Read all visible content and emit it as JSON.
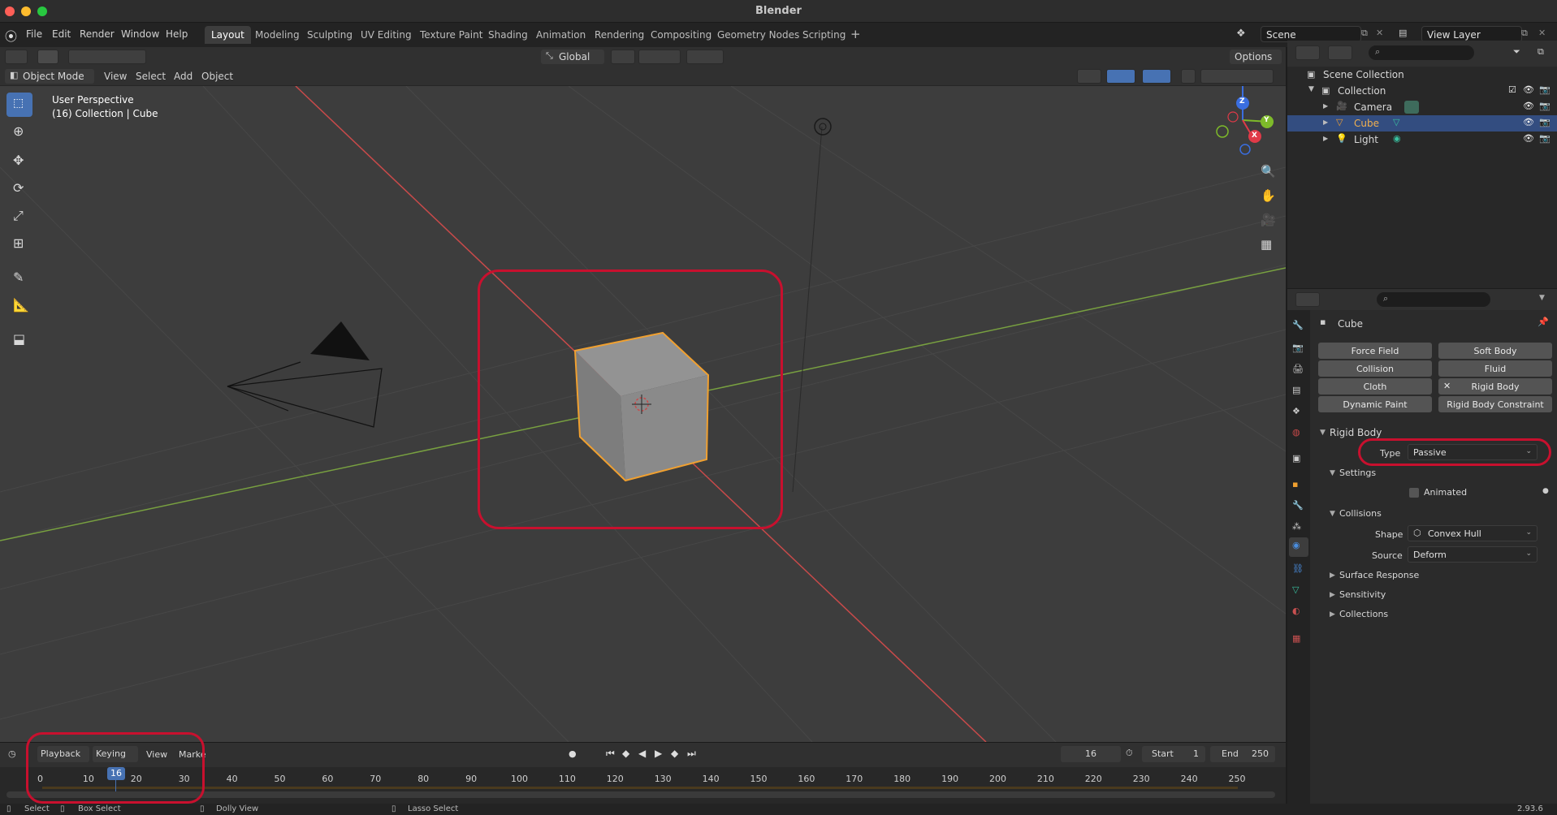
{
  "window": {
    "title": "Blender"
  },
  "menu": [
    "File",
    "Edit",
    "Render",
    "Window",
    "Help"
  ],
  "workspaces": [
    {
      "label": "Layout",
      "active": true
    },
    {
      "label": "Modeling",
      "active": false
    },
    {
      "label": "Sculpting",
      "active": false
    },
    {
      "label": "UV Editing",
      "active": false
    },
    {
      "label": "Texture Paint",
      "active": false
    },
    {
      "label": "Shading",
      "active": false
    },
    {
      "label": "Animation",
      "active": false
    },
    {
      "label": "Rendering",
      "active": false
    },
    {
      "label": "Compositing",
      "active": false
    },
    {
      "label": "Geometry Nodes",
      "active": false
    },
    {
      "label": "Scripting",
      "active": false
    }
  ],
  "scene": {
    "value": "Scene"
  },
  "view_layer": {
    "value": "View Layer"
  },
  "viewport_header": {
    "transform_orientation": "Global",
    "options": "Options",
    "mode": "Object Mode",
    "menus": [
      "View",
      "Select",
      "Add",
      "Object"
    ]
  },
  "viewport": {
    "perspective": "User Perspective",
    "collection_info": "(16) Collection | Cube",
    "gizmo": {
      "z": "Z",
      "y": "Y",
      "x": "X"
    }
  },
  "outliner": {
    "scene_collection": "Scene Collection",
    "collection": "Collection",
    "items": [
      {
        "name": "Camera",
        "selected": false
      },
      {
        "name": "Cube",
        "selected": true
      },
      {
        "name": "Light",
        "selected": false
      }
    ]
  },
  "properties": {
    "object_name": "Cube",
    "physics_buttons": [
      [
        "Force Field",
        "Soft Body"
      ],
      [
        "Collision",
        "Fluid"
      ],
      [
        "Cloth",
        "Rigid Body"
      ],
      [
        "Dynamic Paint",
        "Rigid Body Constraint"
      ]
    ],
    "rigid_body": {
      "panel": "Rigid Body",
      "type_label": "Type",
      "type_value": "Passive",
      "settings": "Settings",
      "animated": "Animated",
      "collisions": "Collisions",
      "shape_label": "Shape",
      "shape_value": "Convex Hull",
      "source_label": "Source",
      "source_value": "Deform",
      "subpanels": [
        "Surface Response",
        "Sensitivity",
        "Collections"
      ]
    }
  },
  "timeline": {
    "menus": [
      "Playback",
      "Keying",
      "View",
      "Marke"
    ],
    "current_frame": "16",
    "start_label": "Start",
    "start_value": "1",
    "end_label": "End",
    "end_value": "250",
    "ticks": [
      "0",
      "10",
      "20",
      "30",
      "40",
      "50",
      "60",
      "70",
      "80",
      "90",
      "100",
      "110",
      "120",
      "130",
      "140",
      "150",
      "160",
      "170",
      "180",
      "190",
      "200",
      "210",
      "220",
      "230",
      "240",
      "250"
    ],
    "playhead": "16"
  },
  "statusbar": {
    "items": [
      "Select",
      "Box Select",
      "Dolly View",
      "Lasso Select"
    ],
    "version": "2.93.6"
  },
  "colors": {
    "accent": "#4772b3",
    "selection": "#f0a030",
    "highlight_box": "#c8102e",
    "x_axis": "#c84a4a",
    "y_axis": "#78a040"
  }
}
